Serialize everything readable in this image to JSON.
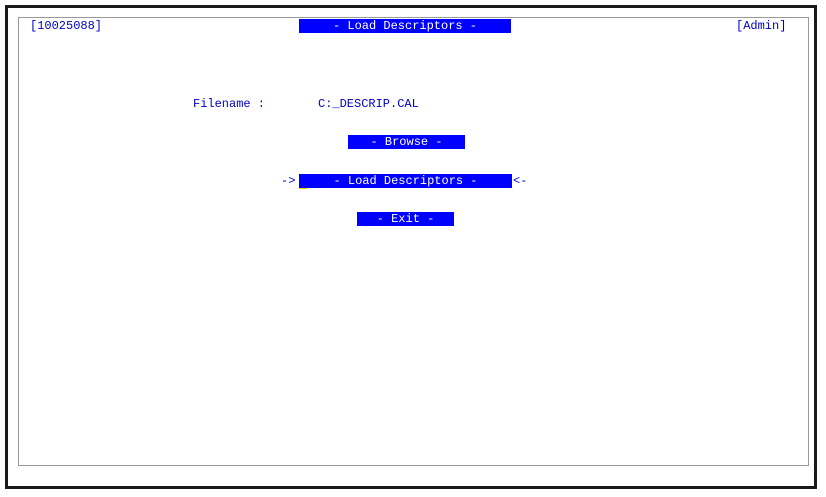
{
  "header": {
    "record_id": "[10025088]",
    "title": "- Load Descriptors -",
    "user": "[Admin]"
  },
  "form": {
    "filename_label": "Filename :",
    "filename_value": "C:_DESCRIP.CAL"
  },
  "buttons": {
    "browse": "- Browse -",
    "load": "- Load Descriptors -",
    "exit": "- Exit -"
  },
  "selection": {
    "left_marker": "->",
    "right_marker": "<-"
  },
  "colors": {
    "highlight_bg": "#0000ff",
    "highlight_fg": "#ffffff",
    "text": "#0000c8",
    "cursor": "#ffcc00"
  }
}
